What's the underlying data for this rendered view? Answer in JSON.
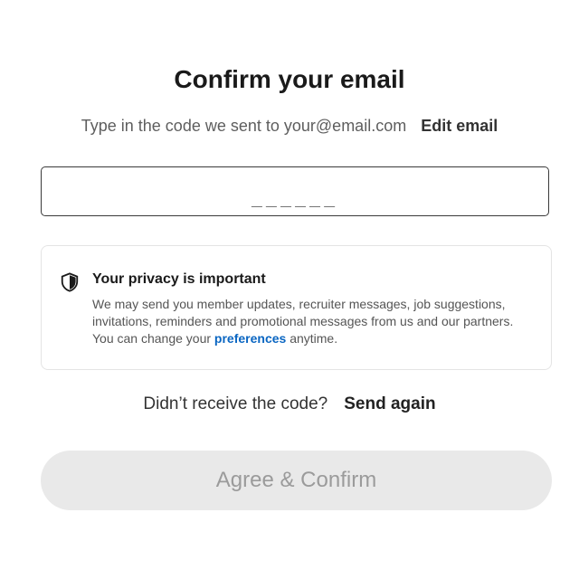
{
  "header": {
    "title": "Confirm your email",
    "subtitle": "Type in the code we sent to your@email.com",
    "edit_email_label": "Edit email"
  },
  "code_input": {
    "value": "",
    "placeholder": "______"
  },
  "privacy": {
    "icon": "shield-icon",
    "heading": "Your privacy is important",
    "body_before_link": "We may send you member updates, recruiter messages, job suggestions, invitations, reminders and promotional messages from us and our partners. You can change your ",
    "link_label": "preferences",
    "body_after_link": " anytime.",
    "link_color": "#0a66c2"
  },
  "resend": {
    "prompt": "Didn’t receive the code?",
    "action_label": "Send again"
  },
  "confirm_button": {
    "label": "Agree & Confirm",
    "state": "disabled"
  }
}
